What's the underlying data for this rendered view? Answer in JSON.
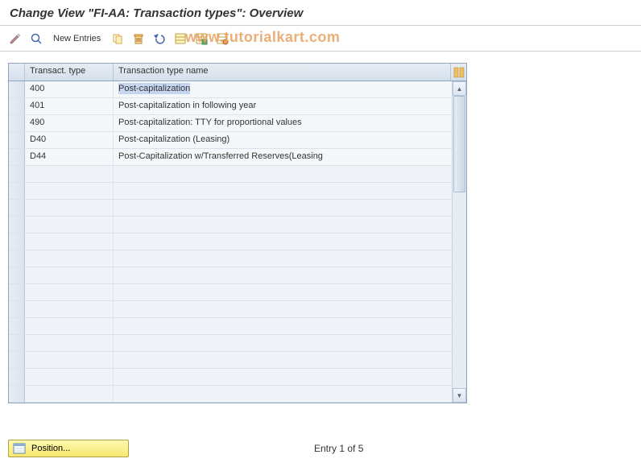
{
  "title": "Change View \"FI-AA: Transaction types\": Overview",
  "toolbar": {
    "new_entries_label": "New Entries"
  },
  "watermark": "www.tutorialkart.com",
  "table": {
    "headers": {
      "type": "Transact. type",
      "name": "Transaction type name"
    },
    "rows": [
      {
        "type": "400",
        "name": "Post-capitalization",
        "selected": true
      },
      {
        "type": "401",
        "name": "Post-capitalization in following year",
        "selected": false
      },
      {
        "type": "490",
        "name": "Post-capitalization: TTY for proportional values",
        "selected": false
      },
      {
        "type": "D40",
        "name": "Post-capitalization (Leasing)",
        "selected": false
      },
      {
        "type": "D44",
        "name": "Post-Capitalization w/Transferred Reserves(Leasing",
        "selected": false
      }
    ],
    "empty_rows": 14
  },
  "footer": {
    "position_label": "Position...",
    "entry_text": "Entry 1 of 5"
  }
}
